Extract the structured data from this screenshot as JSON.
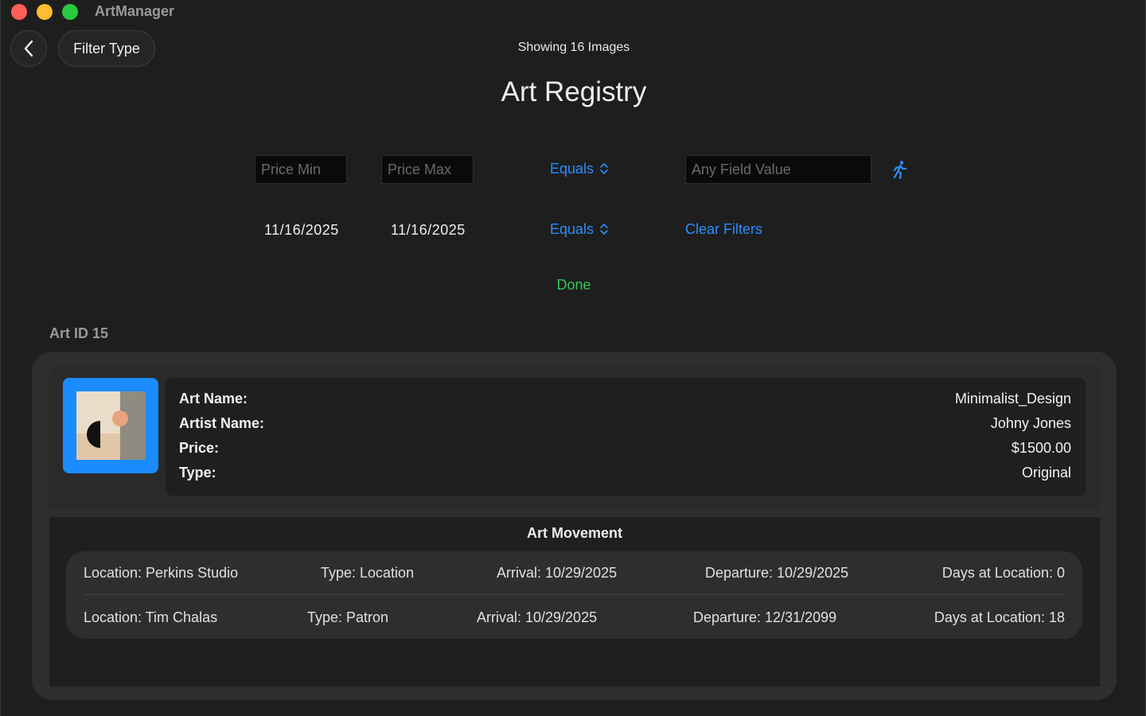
{
  "app": {
    "title": "ArtManager"
  },
  "toolbar": {
    "filter_type_label": "Filter Type",
    "showing_text": "Showing 16 Images"
  },
  "page": {
    "title": "Art Registry"
  },
  "filters": {
    "price_min_placeholder": "Price Min",
    "price_max_placeholder": "Price Max",
    "price_operator": "Equals",
    "any_field_placeholder": "Any Field Value",
    "date_from": "11/16/2025",
    "date_to": "11/16/2025",
    "date_operator": "Equals",
    "clear_label": "Clear Filters",
    "done_label": "Done"
  },
  "art": {
    "section_label": "Art ID 15",
    "fields": [
      {
        "label": "Art Name:",
        "value": "Minimalist_Design"
      },
      {
        "label": "Artist Name:",
        "value": "Johny Jones"
      },
      {
        "label": "Price:",
        "value": "$1500.00"
      },
      {
        "label": "Type:",
        "value": "Original"
      }
    ]
  },
  "movement": {
    "title": "Art Movement",
    "rows": [
      {
        "location": "Location: Perkins Studio",
        "type": "Type: Location",
        "arrival": "Arrival:  10/29/2025",
        "departure": "Departure:  10/29/2025",
        "days": "Days at Location:  0"
      },
      {
        "location": "Location: Tim Chalas",
        "type": "Type: Patron",
        "arrival": "Arrival:  10/29/2025",
        "departure": "Departure:  12/31/2099",
        "days": "Days at Location:  18"
      }
    ]
  },
  "colors": {
    "accent": "#2a8cff",
    "done": "#34c759",
    "thumb_bg": "#1a8cff"
  },
  "icons": {
    "back": "chevron-left-icon",
    "search_run": "running-figure-icon",
    "stepper": "chevron-up-down-icon"
  }
}
